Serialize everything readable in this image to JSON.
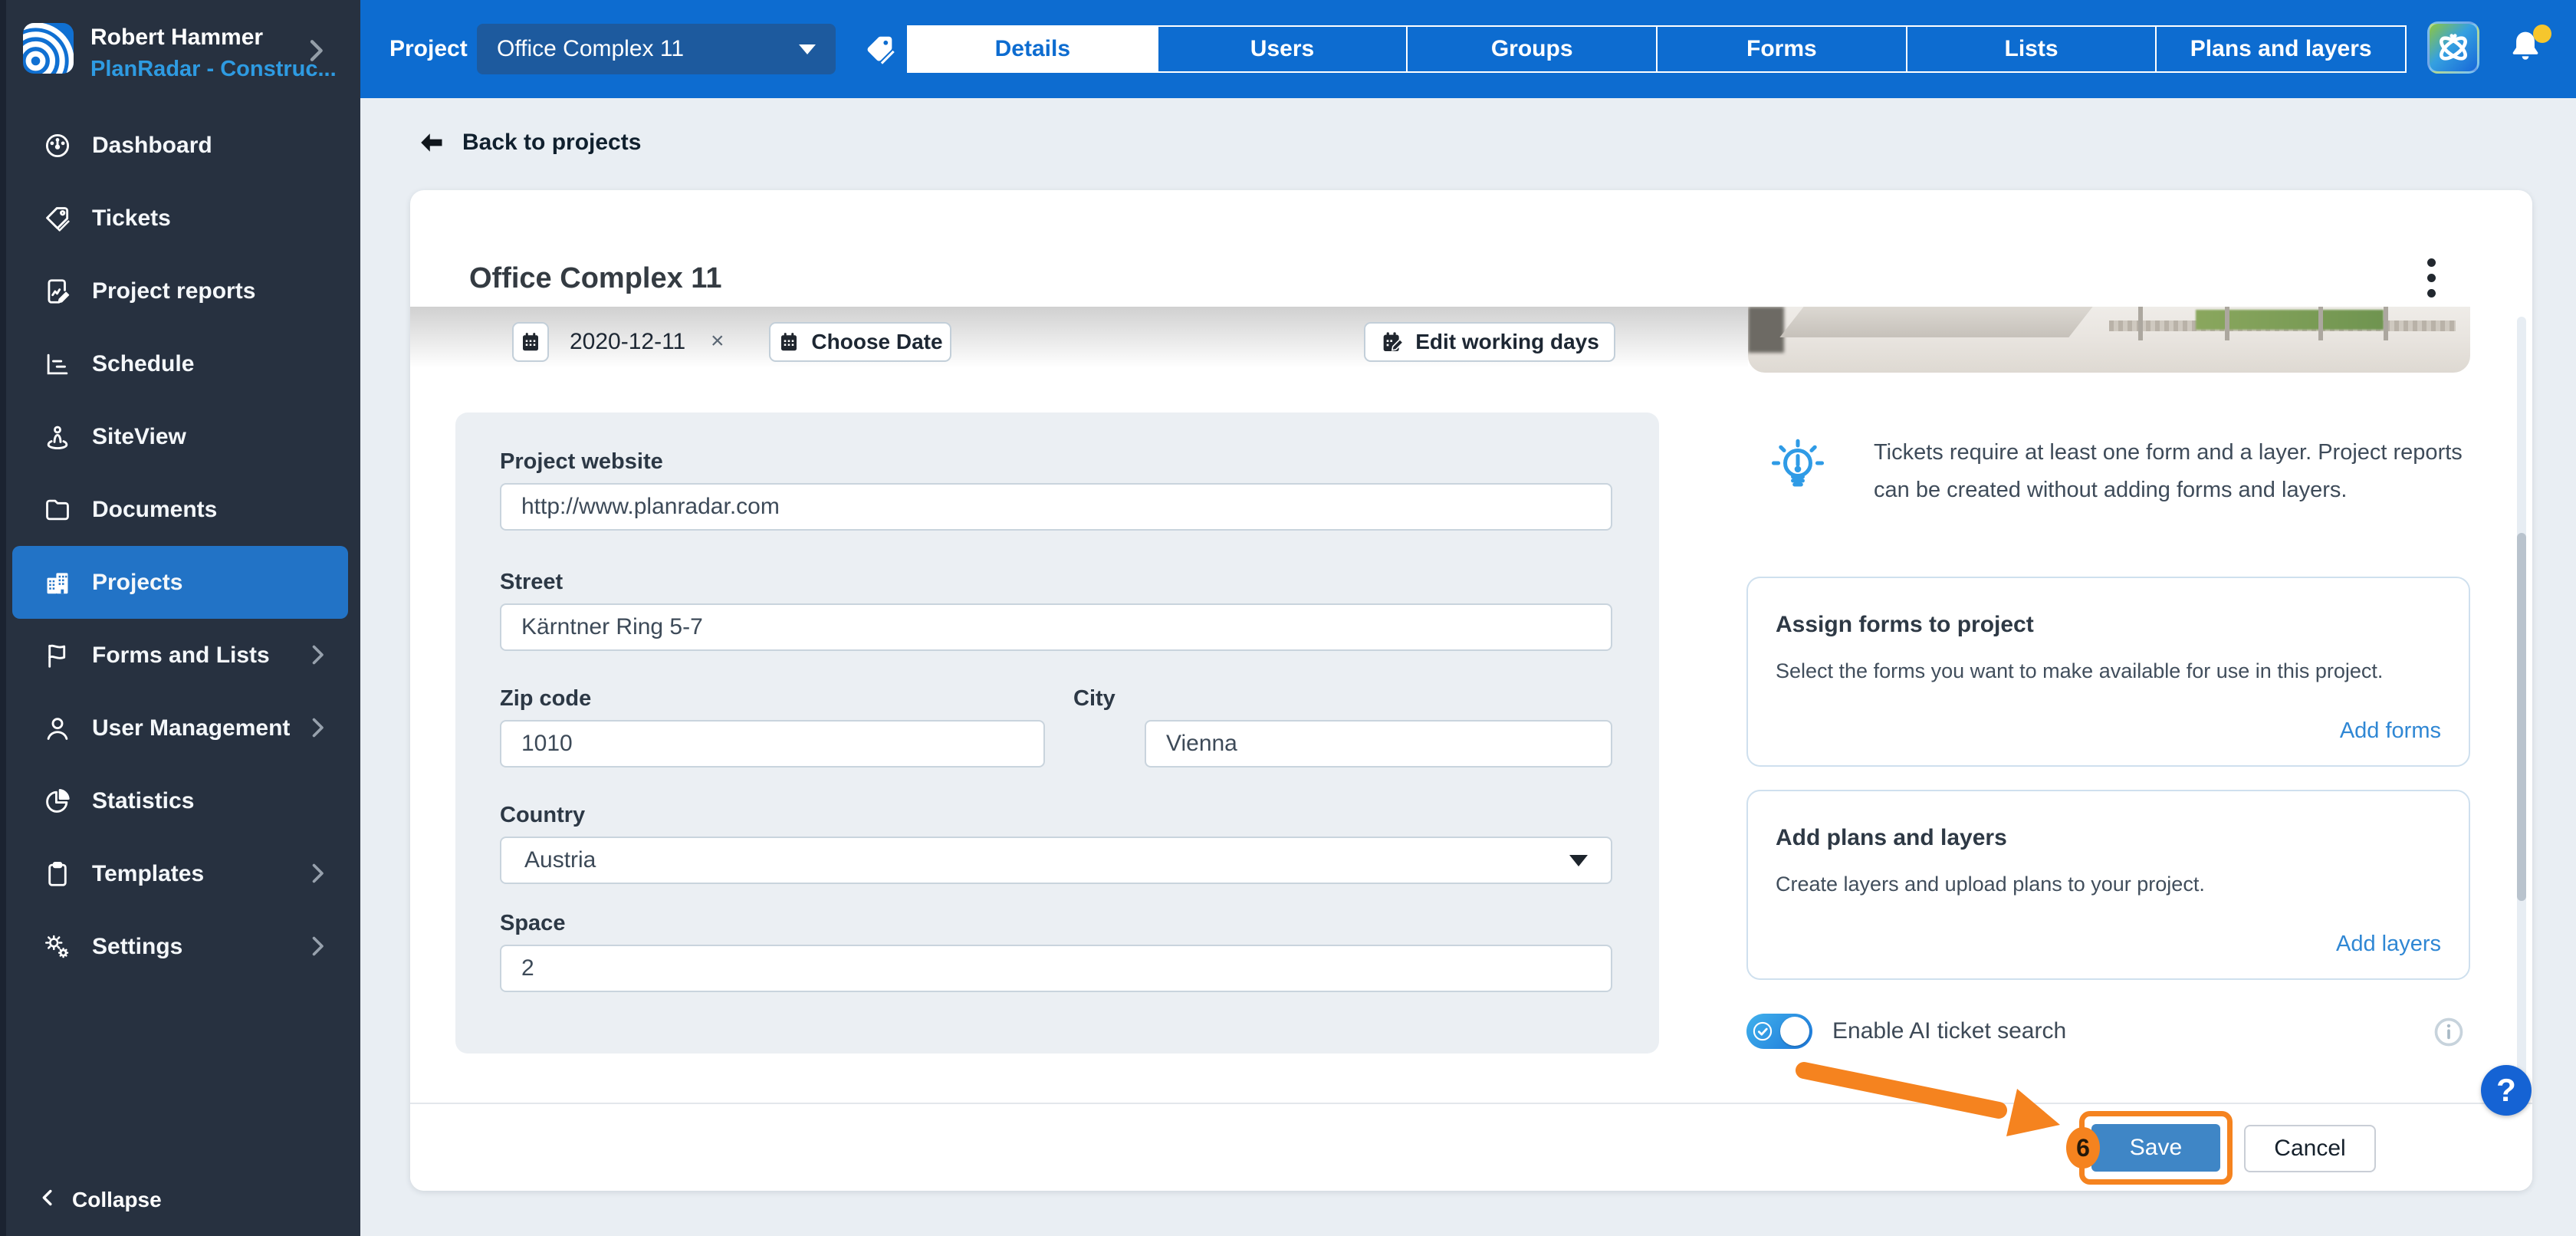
{
  "sidebar": {
    "profile": {
      "name": "Robert Hammer",
      "account": "PlanRadar - Construc..."
    },
    "items": [
      {
        "label": "Dashboard",
        "icon": "dashboard-icon",
        "selected": false,
        "chevron": false
      },
      {
        "label": "Tickets",
        "icon": "ticket-tag-icon",
        "selected": false,
        "chevron": false
      },
      {
        "label": "Project reports",
        "icon": "report-pen-icon",
        "selected": false,
        "chevron": false
      },
      {
        "label": "Schedule",
        "icon": "gantt-icon",
        "selected": false,
        "chevron": false
      },
      {
        "label": "SiteView",
        "icon": "person-pin-icon",
        "selected": false,
        "chevron": false
      },
      {
        "label": "Documents",
        "icon": "folder-icon",
        "selected": false,
        "chevron": false
      },
      {
        "label": "Projects",
        "icon": "building-icon",
        "selected": true,
        "chevron": false
      },
      {
        "label": "Forms and Lists",
        "icon": "flag-icon",
        "selected": false,
        "chevron": true
      },
      {
        "label": "User Management",
        "icon": "person-icon",
        "selected": false,
        "chevron": true
      },
      {
        "label": "Statistics",
        "icon": "pie-chart-icon",
        "selected": false,
        "chevron": false
      },
      {
        "label": "Templates",
        "icon": "clipboard-icon",
        "selected": false,
        "chevron": true
      },
      {
        "label": "Settings",
        "icon": "gears-icon",
        "selected": false,
        "chevron": true
      }
    ],
    "collapse_label": "Collapse"
  },
  "topbar": {
    "project_label": "Project",
    "selected_project": "Office Complex 11",
    "tabs": [
      {
        "label": "Details",
        "active": true
      },
      {
        "label": "Users",
        "active": false
      },
      {
        "label": "Groups",
        "active": false
      },
      {
        "label": "Forms",
        "active": false
      },
      {
        "label": "Lists",
        "active": false
      },
      {
        "label": "Plans and layers",
        "active": false
      }
    ]
  },
  "page": {
    "back_link": "Back to projects",
    "card_title": "Office Complex 11"
  },
  "dates": {
    "start_date": "2020-12-11",
    "clear_symbol": "×",
    "choose_date_label": "Choose Date",
    "edit_working_days_label": "Edit working days"
  },
  "form": {
    "website": {
      "label": "Project website",
      "value": "http://www.planradar.com"
    },
    "street": {
      "label": "Street",
      "value": "Kärntner Ring 5-7"
    },
    "zip": {
      "label": "Zip code",
      "value": "1010"
    },
    "city": {
      "label": "City",
      "value": "Vienna"
    },
    "country": {
      "label": "Country",
      "value": "Austria"
    },
    "space": {
      "label": "Space",
      "value": "2"
    }
  },
  "right_column": {
    "tip": "Tickets require at least one form and a layer. Project reports can be created without adding forms and layers.",
    "forms_card": {
      "title": "Assign forms to project",
      "body": "Select the forms you want to make available for use in this project.",
      "link": "Add forms"
    },
    "plans_card": {
      "title": "Add plans and layers",
      "body": "Create layers and upload plans to your project.",
      "link": "Add layers"
    },
    "ai_toggle": {
      "label": "Enable AI ticket search",
      "state": "on"
    }
  },
  "footer": {
    "save_label": "Save",
    "cancel_label": "Cancel"
  },
  "annotation": {
    "step_number": "6"
  },
  "help": {
    "label": "?"
  },
  "colors": {
    "topbar_blue": "#0d6cd0",
    "sidebar_navy": "#273140",
    "selected_item_blue": "#2273c6",
    "annotation_orange": "#f5831f",
    "save_button_blue": "#3f86c6",
    "link_blue": "#2f87d4",
    "notification_yellow": "#f6c62d"
  }
}
